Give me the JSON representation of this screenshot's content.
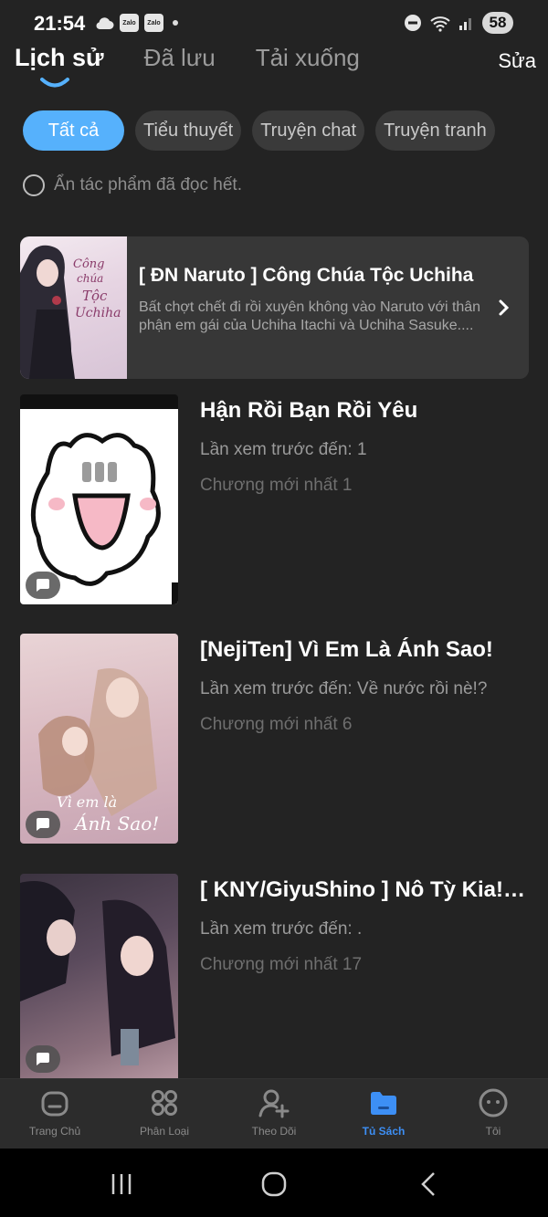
{
  "status_bar": {
    "time": "21:54",
    "zalo_label": "Zalo",
    "battery": "58"
  },
  "tabs": [
    {
      "label": "Lịch sử",
      "active": true
    },
    {
      "label": "Đã lưu",
      "active": false
    },
    {
      "label": "Tải xuống",
      "active": false
    }
  ],
  "edit_label": "Sửa",
  "filters": [
    {
      "label": "Tất cả",
      "active": true
    },
    {
      "label": "Tiểu thuyết",
      "active": false
    },
    {
      "label": "Truyện chat",
      "active": false
    },
    {
      "label": "Truyện tranh",
      "active": false
    }
  ],
  "hide_finished_label": "Ẩn tác phẩm đã đọc hết.",
  "featured": {
    "title": "[ ĐN Naruto ] Công Chúa Tộc Uchiha",
    "description": "Bất chợt chết đi rồi xuyên không vào Naruto với thân phận em gái của Uchiha Itachi và Uchiha Sasuke....",
    "cover_text": "Công chúa Tộc Uchiha"
  },
  "items": [
    {
      "title": "Hận Rồi Bạn Rồi Yêu",
      "last_read": "Lần xem trước đến: 1",
      "latest": "Chương mới nhất 1"
    },
    {
      "title": "[NejiTen] Vì Em Là Ánh Sao!",
      "last_read": "Lần xem trước đến: Về nước rồi nè!?",
      "latest": "Chương mới nhất 6"
    },
    {
      "title": "[ KNY/GiyuShino ] Nô Tỳ Kia! N...",
      "last_read": "Lần xem trước đến: .",
      "latest": "Chương mới nhất 17"
    }
  ],
  "bottom_nav": [
    {
      "label": "Trang Chủ",
      "icon": "home-icon",
      "active": false
    },
    {
      "label": "Phân Loại",
      "icon": "grid-icon",
      "active": false
    },
    {
      "label": "Theo Dõi",
      "icon": "follow-user-icon",
      "active": false
    },
    {
      "label": "Tủ Sách",
      "icon": "folder-icon",
      "active": true
    },
    {
      "label": "Tôi",
      "icon": "face-icon",
      "active": false
    }
  ],
  "colors": {
    "accent": "#56b1fc",
    "nav_active": "#3d8ff5",
    "background": "#232323"
  }
}
